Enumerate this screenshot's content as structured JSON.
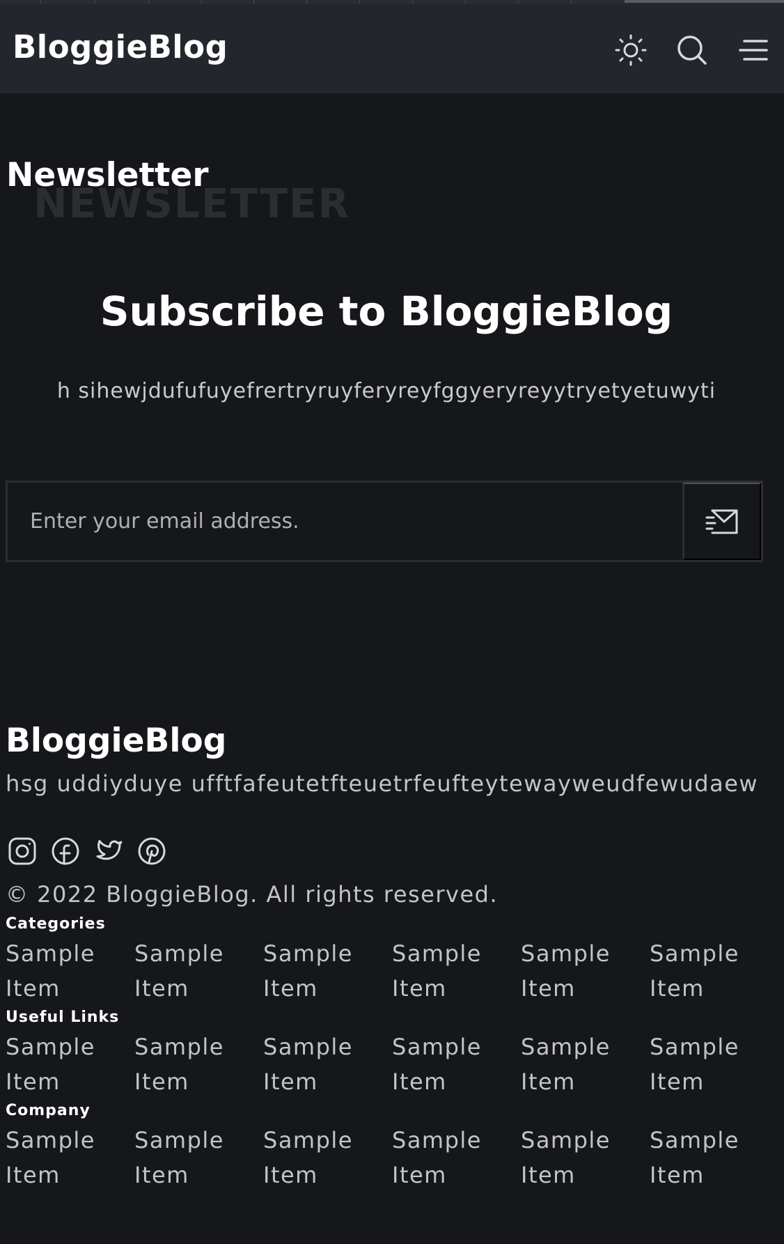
{
  "header": {
    "logo": "BloggieBlog",
    "icons": [
      "sun-icon",
      "search-icon",
      "menu-icon"
    ]
  },
  "newsletter": {
    "section_title": "Newsletter",
    "watermark": "NEWSLETTER",
    "title": "Subscribe to BloggieBlog",
    "description": "h sihewjdufufuyefrertryruyferyreyfggyeryreyytryetyetuwyti",
    "email_placeholder": "Enter your email address."
  },
  "footer": {
    "logo": "BloggieBlog",
    "description": "hsg uddiyduye ufftfafeutetfteuetrfeufteytewayweudfewudaew",
    "social_icons": [
      "instagram-icon",
      "facebook-icon",
      "twitter-icon",
      "pinterest-icon"
    ],
    "copyright": "© 2022 BloggieBlog. All rights reserved.",
    "groups": [
      {
        "title": "Categories",
        "items": [
          "Sample Item",
          "Sample Item",
          "Sample Item",
          "Sample Item",
          "Sample Item",
          "Sample Item"
        ]
      },
      {
        "title": "Useful Links",
        "items": [
          "Sample Item",
          "Sample Item",
          "Sample Item",
          "Sample Item",
          "Sample Item",
          "Sample Item"
        ]
      },
      {
        "title": "Company",
        "items": [
          "Sample Item",
          "Sample Item",
          "Sample Item",
          "Sample Item",
          "Sample Item",
          "Sample Item"
        ]
      }
    ]
  }
}
